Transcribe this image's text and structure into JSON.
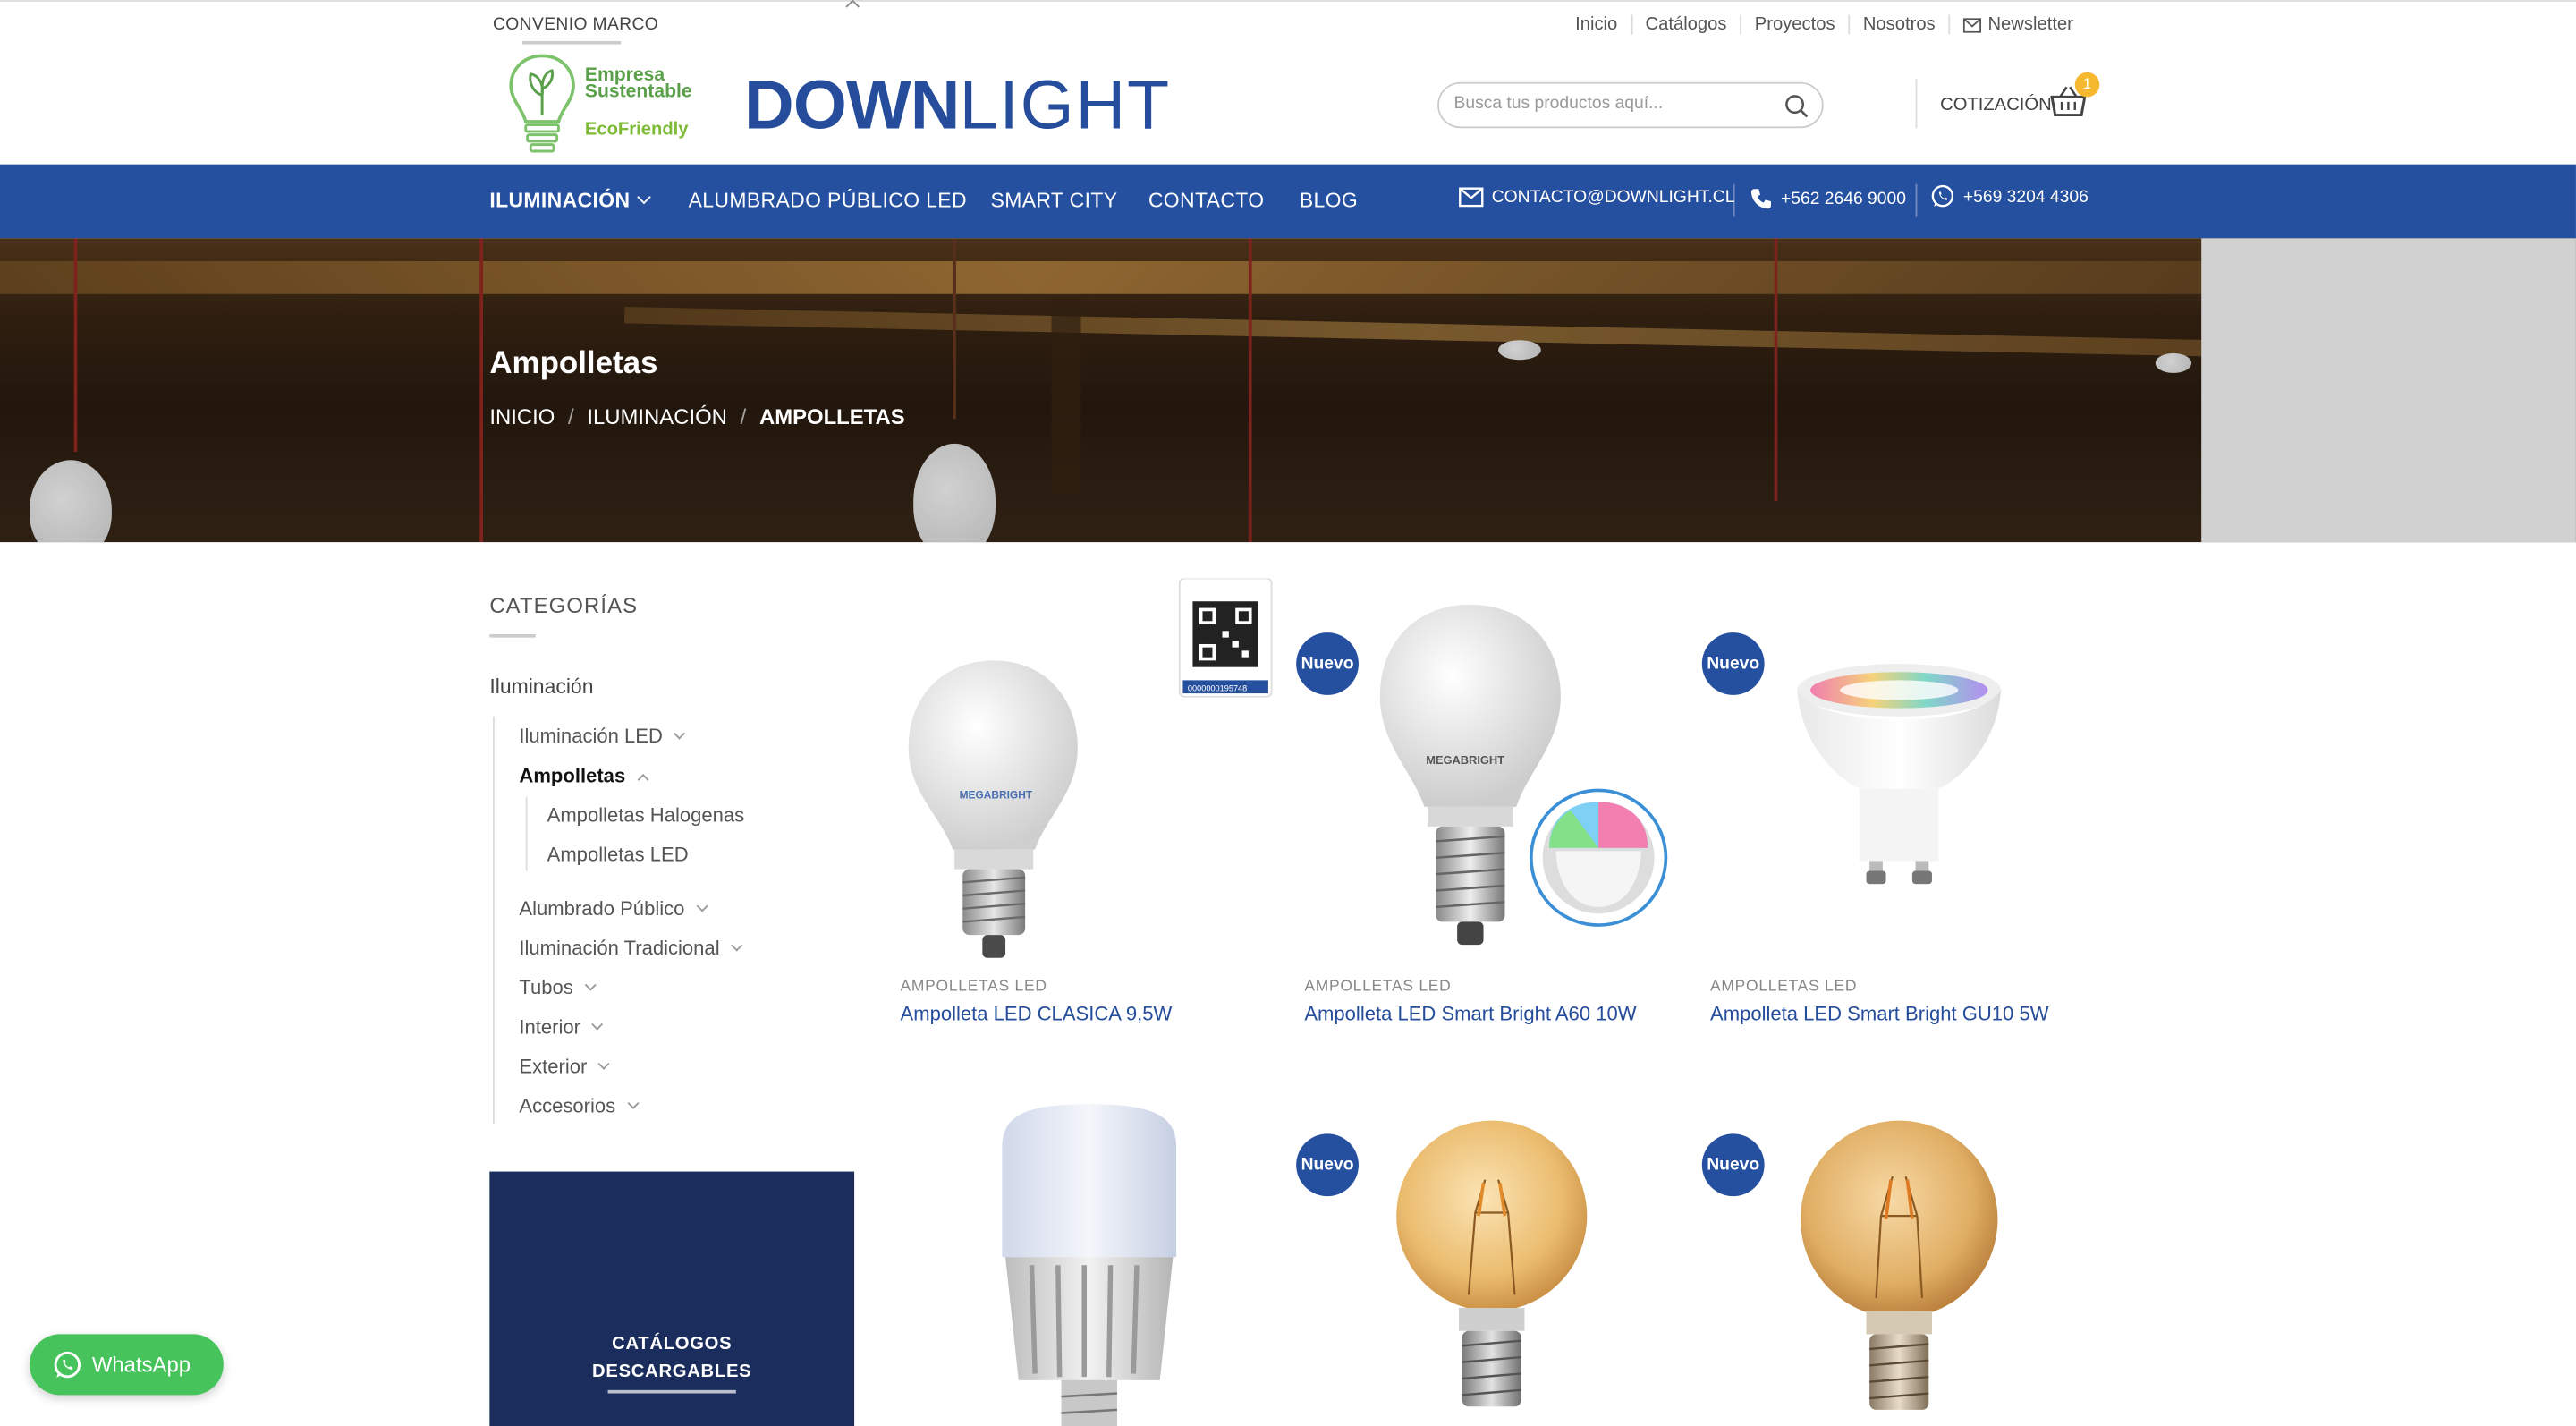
{
  "topbar": {
    "convenio": "CONVENIO MARCO",
    "links": [
      "Inicio",
      "Catálogos",
      "Proyectos",
      "Nosotros"
    ],
    "newsletter": "Newsletter"
  },
  "header": {
    "eco_line1": "Empresa",
    "eco_line2": "Sustentable",
    "eco_line3": "EcoFriendly",
    "logo_bold": "DOWN",
    "logo_light": "LIGHT",
    "search_placeholder": "Busca tus productos aquí...",
    "quote_label": "COTIZACIÓN",
    "cart_count": "1"
  },
  "mainnav": {
    "items": [
      "ILUMINACIÓN",
      "ALUMBRADO PÚBLICO LED",
      "SMART CITY",
      "CONTACTO",
      "BLOG"
    ],
    "email": "CONTACTO@DOWNLIGHT.CL",
    "phone": "+562 2646 9000",
    "whatsapp": "+569 3204 4306"
  },
  "hero": {
    "title": "Ampolletas",
    "breadcrumb": [
      "INICIO",
      "ILUMINACIÓN",
      "AMPOLLETAS"
    ]
  },
  "sidebar": {
    "title": "CATEGORÍAS",
    "root": "Iluminación",
    "items": [
      "Iluminación LED",
      "Ampolletas",
      "Ampolletas Halogenas",
      "Ampolletas LED",
      "Alumbrado Público",
      "Iluminación Tradicional",
      "Tubos",
      "Interior",
      "Exterior",
      "Accesorios"
    ],
    "catalog_line1": "CATÁLOGOS",
    "catalog_line2": "DESCARGABLES"
  },
  "products": [
    {
      "category": "AMPOLLETAS LED",
      "name": "Ampolleta LED CLASICA 9,5W",
      "is_new": false
    },
    {
      "category": "AMPOLLETAS LED",
      "name": "Ampolleta LED Smart Bright A60 10W",
      "is_new": true
    },
    {
      "category": "AMPOLLETAS LED",
      "name": "Ampolleta LED Smart Bright GU10 5W",
      "is_new": true
    },
    {
      "category": "",
      "name": "",
      "is_new": false
    },
    {
      "category": "",
      "name": "",
      "is_new": true
    },
    {
      "category": "",
      "name": "",
      "is_new": true
    }
  ],
  "badge_label": "Nuevo",
  "qr_code_text": "0000000195748",
  "bulb_brand": "MEGABRIGHT",
  "whatsapp_button": "WhatsApp",
  "colors": {
    "brand_blue": "#254f9f",
    "dark_navy": "#1a2d5c",
    "whatsapp_green": "#46c35a",
    "badge_yellow": "#f5b82e"
  }
}
